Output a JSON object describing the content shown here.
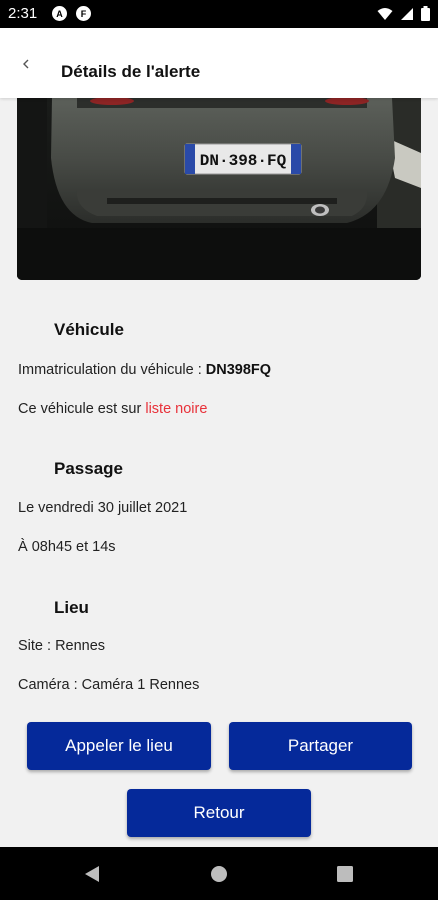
{
  "status_bar": {
    "time": "2:31",
    "icons": [
      "app-a-icon",
      "app-f-icon",
      "wifi-icon",
      "signal-icon",
      "battery-icon"
    ],
    "app_icon_1": "A",
    "app_icon_2": "F"
  },
  "app_bar": {
    "title": "Détails de l'alerte",
    "back_icon": "chevron-left-icon"
  },
  "photo": {
    "plate_text": "DN·398·FQ"
  },
  "vehicle": {
    "heading": "Véhicule",
    "plate_label": "Immatriculation du véhicule : ",
    "plate_value": "DN398FQ",
    "list_prefix": "Ce véhicule est sur ",
    "list_link": "liste noire"
  },
  "passage": {
    "heading": "Passage",
    "date": "Le vendredi 30 juillet 2021",
    "time": "À 08h45 et 14s"
  },
  "location": {
    "heading": "Lieu",
    "site": "Site : Rennes",
    "camera": "Caméra : Caméra 1 Rennes"
  },
  "buttons": {
    "call": "Appeler le lieu",
    "share": "Partager",
    "back": "Retour"
  },
  "colors": {
    "primary": "#05299a",
    "link_red": "#e8313a",
    "background": "#f1f1f1"
  },
  "nav_bar": {
    "icons": [
      "back-triangle-icon",
      "home-circle-icon",
      "recents-square-icon"
    ]
  }
}
